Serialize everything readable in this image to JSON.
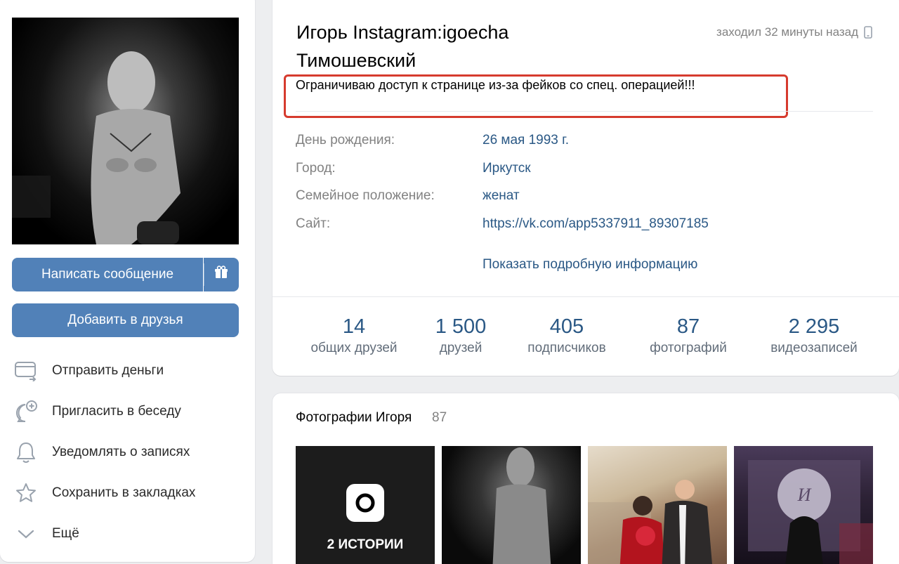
{
  "profile": {
    "name": "Игорь Instagram:igoecha Тимошевский",
    "last_seen": "заходил 32 минуты назад",
    "status": "Ограничиваю доступ к странице из-за фейков со спец. операцией!!!",
    "info": [
      {
        "label": "День рождения:",
        "value": "26 мая 1993 г."
      },
      {
        "label": "Город:",
        "value": "Иркутск"
      },
      {
        "label": "Семейное положение:",
        "value": "женат"
      },
      {
        "label": "Сайт:",
        "value": "https://vk.com/app5337911_89307185"
      }
    ],
    "show_more": "Показать подробную информацию",
    "counters": [
      {
        "num": "14",
        "label": "общих друзей"
      },
      {
        "num": "1 500",
        "label": "друзей"
      },
      {
        "num": "405",
        "label": "подписчиков"
      },
      {
        "num": "87",
        "label": "фотографий"
      },
      {
        "num": "2 295",
        "label": "видеозаписей"
      }
    ]
  },
  "actions": {
    "message": "Написать сообщение",
    "add_friend": "Добавить в друзья",
    "menu": [
      {
        "label": "Отправить деньги",
        "icon": "money-transfer-icon"
      },
      {
        "label": "Пригласить в беседу",
        "icon": "chat-add-icon"
      },
      {
        "label": "Уведомлять о записях",
        "icon": "bell-icon"
      },
      {
        "label": "Сохранить в закладках",
        "icon": "star-icon"
      },
      {
        "label": "Ещё",
        "icon": "chevron-down-icon"
      }
    ]
  },
  "photos": {
    "title": "Фотографии Игоря",
    "count": "87",
    "stories_label": "2 ИСТОРИИ"
  },
  "colors": {
    "accent": "#5181b8",
    "link": "#2a5885",
    "status_highlight": "#d63b2e",
    "background": "#edeef0"
  }
}
